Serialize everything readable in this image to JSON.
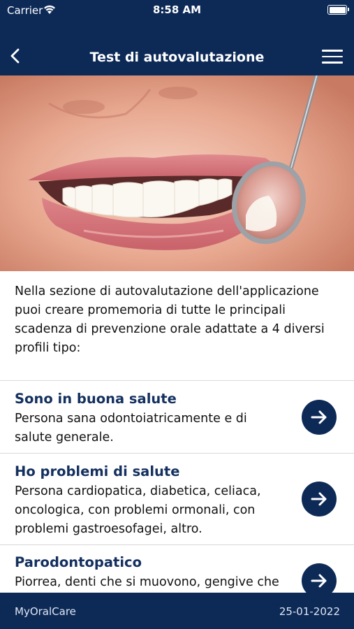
{
  "status_bar": {
    "carrier": "Carrier",
    "time": "8:58 AM"
  },
  "nav": {
    "title": "Test di autovalutazione",
    "back_icon": "chevron-left-icon",
    "menu_icon": "hamburger-menu-icon"
  },
  "hero": {
    "image": "smiling-mouth-with-dental-mirror"
  },
  "intro": "Nella sezione di autovalutazione dell'applicazione puoi creare promemoria di tutte le principali scadenza di prevenzione orale adattate a 4 diversi profili tipo:",
  "profiles": [
    {
      "title": "Sono in buona salute",
      "description": "Persona sana odontoiatricamente e di salute generale."
    },
    {
      "title": "Ho problemi di salute",
      "description": "Persona cardiopatica, diabetica, celiaca, oncologica, con problemi ormonali, con problemi gastroesofagei, altro."
    },
    {
      "title": "Parodontopatico",
      "description": "Piorrea, denti che si muovono, gengive che"
    }
  ],
  "footer": {
    "app_name": "MyOralCare",
    "date": "25-01-2022"
  },
  "colors": {
    "brand": "#0d2a57",
    "title": "#14305f"
  }
}
